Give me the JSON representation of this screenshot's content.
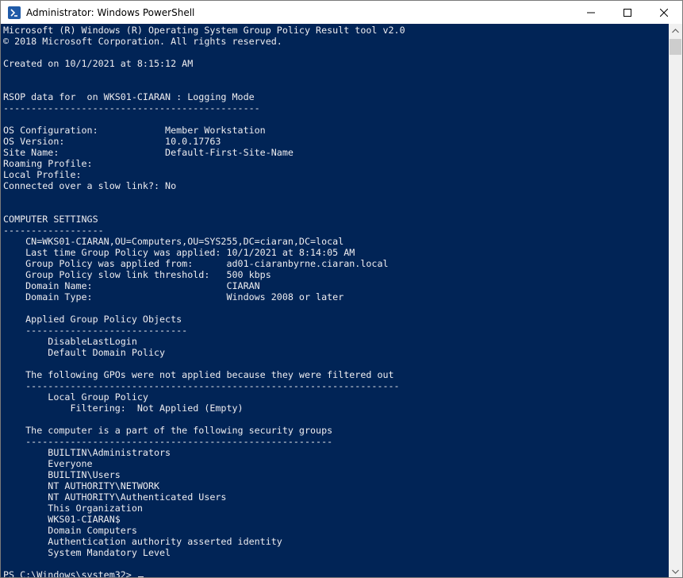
{
  "window": {
    "title": "Administrator: Windows PowerShell",
    "icon": "powershell-icon",
    "controls": [
      "minimize-icon",
      "maximize-icon",
      "close-icon"
    ]
  },
  "colors": {
    "console_background": "#012456",
    "console_text": "#eeedf0",
    "titlebar": "#ffffff"
  },
  "console": {
    "lines": [
      "Microsoft (R) Windows (R) Operating System Group Policy Result tool v2.0",
      "© 2018 Microsoft Corporation. All rights reserved.",
      "",
      "Created on ‎10/‎1/‎2021 at 8:15:12 AM",
      "",
      "",
      "RSOP data for  on WKS01-CIARAN : Logging Mode",
      "----------------------------------------------",
      "",
      "OS Configuration:            Member Workstation",
      "OS Version:                  10.0.17763",
      "Site Name:                   Default-First-Site-Name",
      "Roaming Profile:",
      "Local Profile:",
      "Connected over a slow link?: No",
      "",
      "",
      "COMPUTER SETTINGS",
      "------------------",
      "    CN=WKS01-CIARAN,OU=Computers,OU=SYS255,DC=ciaran,DC=local",
      "    Last time Group Policy was applied: 10/1/2021 at 8:14:05 AM",
      "    Group Policy was applied from:      ad01-ciaranbyrne.ciaran.local",
      "    Group Policy slow link threshold:   500 kbps",
      "    Domain Name:                        CIARAN",
      "    Domain Type:                        Windows 2008 or later",
      "",
      "    Applied Group Policy Objects",
      "    -----------------------------",
      "        DisableLastLogin",
      "        Default Domain Policy",
      "",
      "    The following GPOs were not applied because they were filtered out",
      "    -------------------------------------------------------------------",
      "        Local Group Policy",
      "            Filtering:  Not Applied (Empty)",
      "",
      "    The computer is a part of the following security groups",
      "    -------------------------------------------------------",
      "        BUILTIN\\Administrators",
      "        Everyone",
      "        BUILTIN\\Users",
      "        NT AUTHORITY\\NETWORK",
      "        NT AUTHORITY\\Authenticated Users",
      "        This Organization",
      "        WKS01-CIARAN$",
      "        Domain Computers",
      "        Authentication authority asserted identity",
      "        System Mandatory Level",
      "",
      "PS C:\\Windows\\system32> "
    ]
  }
}
